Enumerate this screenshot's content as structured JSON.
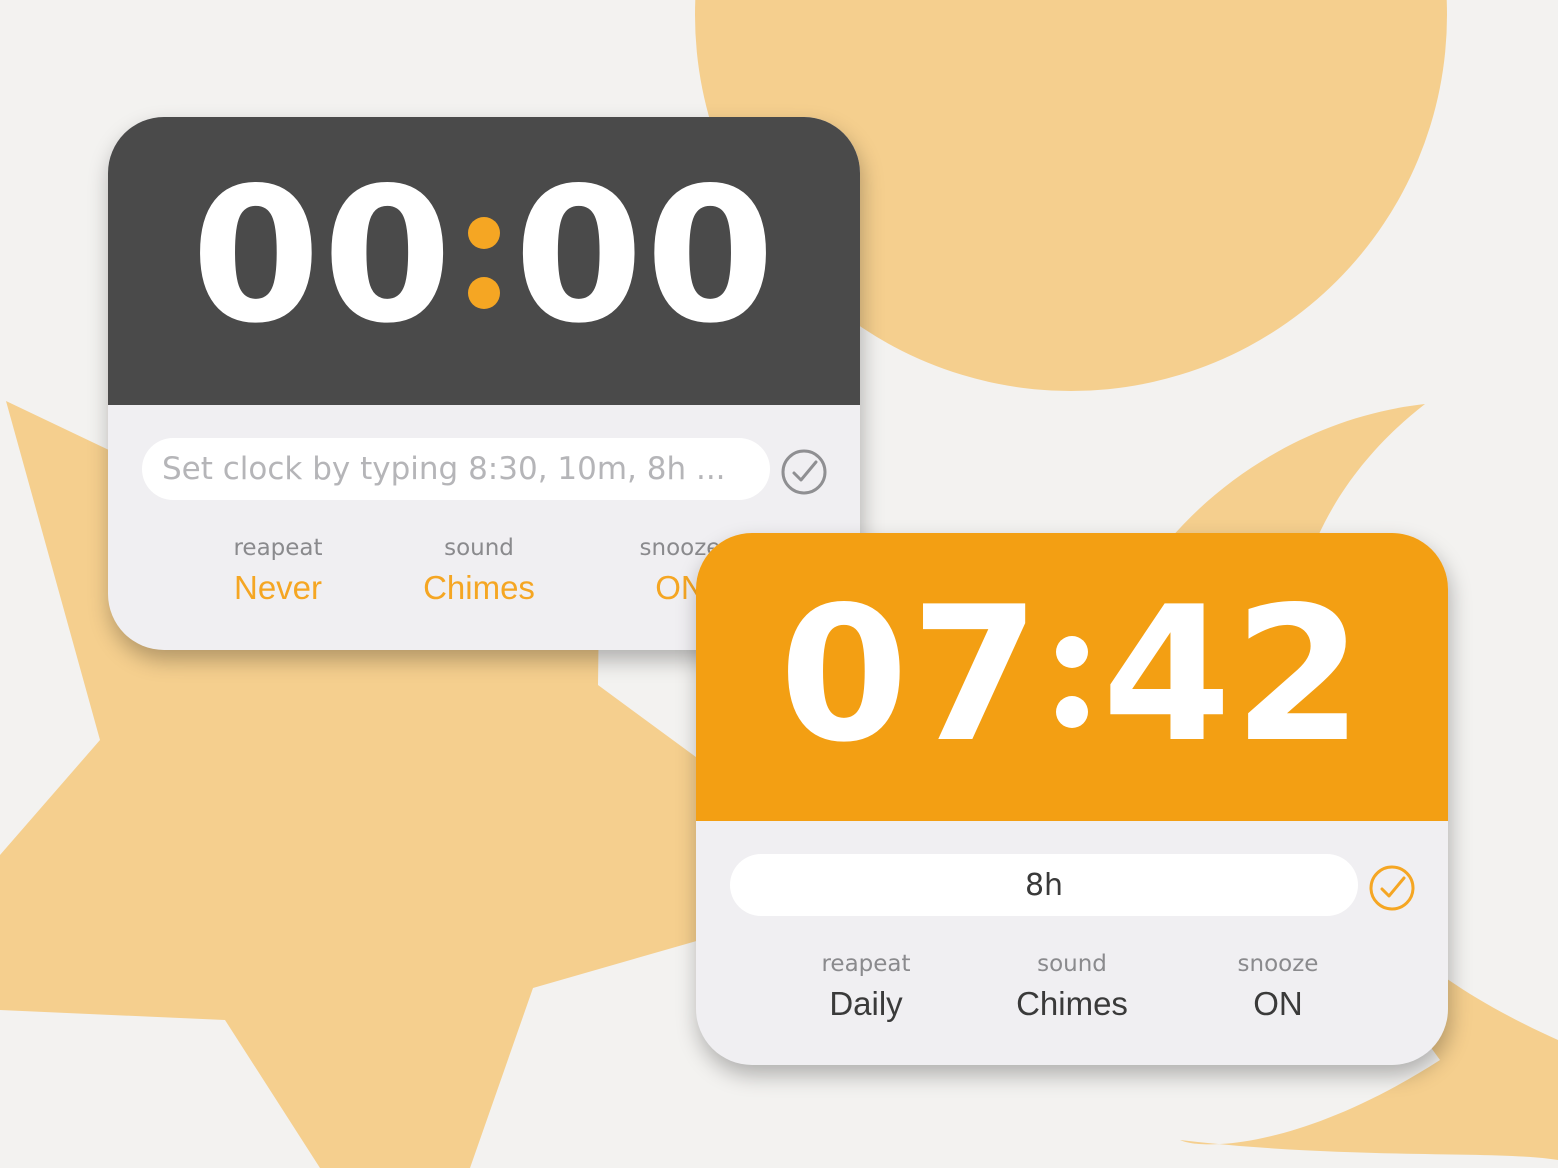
{
  "colors": {
    "background": "#f3f2f0",
    "shape": "#f5cf8e",
    "dark_display": "#4a4a4a",
    "orange_display": "#f39f13",
    "accent": "#f5a623"
  },
  "clock_a": {
    "time_hours": "00",
    "time_minutes": "00",
    "input_placeholder": "Set clock by typing 8:30, 10m, 8h ...",
    "input_value": "",
    "confirm_icon": "check-circle-icon",
    "settings": [
      {
        "label": "reapeat",
        "value": "Never"
      },
      {
        "label": "sound",
        "value": "Chimes"
      },
      {
        "label": "snooze",
        "value": "ON"
      }
    ]
  },
  "clock_b": {
    "time_hours": "07",
    "time_minutes": "42",
    "input_value": "8h",
    "confirm_icon": "check-circle-icon",
    "settings": [
      {
        "label": "reapeat",
        "value": "Daily"
      },
      {
        "label": "sound",
        "value": "Chimes"
      },
      {
        "label": "snooze",
        "value": "ON"
      }
    ]
  }
}
